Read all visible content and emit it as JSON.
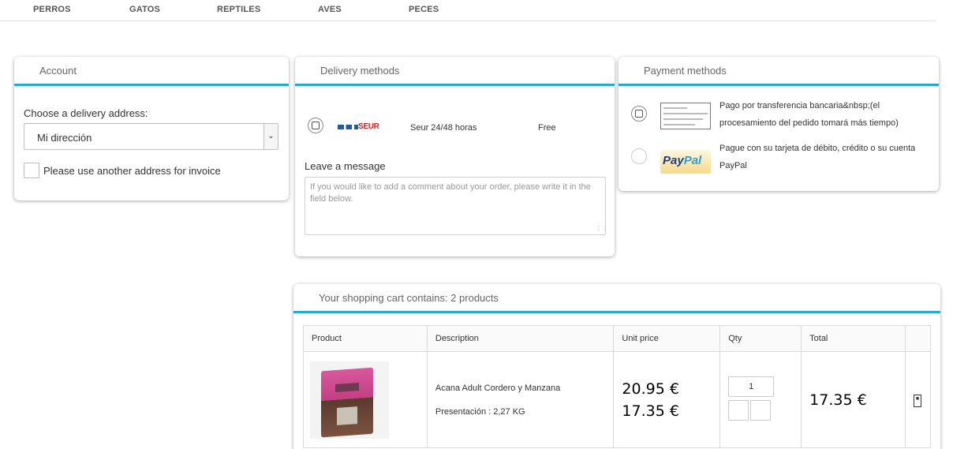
{
  "nav": {
    "items": [
      "PERROS",
      "GATOS",
      "REPTILES",
      "AVES",
      "PECES"
    ]
  },
  "account": {
    "title": "Account",
    "address_label": "Choose a delivery address:",
    "address_selected": "Mi dirección",
    "invoice_label": "Please use another address for invoice"
  },
  "delivery": {
    "title": "Delivery methods",
    "carrier_logo": "SEUR",
    "carrier_name": "Seur 24/48 horas",
    "carrier_price": "Free",
    "message_label": "Leave a message",
    "message_placeholder": "If you would like to add a comment about your order, please write it in the field below."
  },
  "payment": {
    "title": "Payment methods",
    "bank_transfer": "Pago por transferencia bancaria&nbsp;(el procesamiento del pedido tomará más tiempo)",
    "paypal_logo_pay": "Pay",
    "paypal_logo_pal": "Pal",
    "paypal": "Pague con su tarjeta de débito, crédito o su cuenta PayPal"
  },
  "cart": {
    "title": "Your shopping cart contains: 2 products",
    "headers": [
      "Product",
      "Description",
      "Unit price",
      "Qty",
      "Total"
    ],
    "rows": [
      {
        "name": "Acana Adult Cordero y Manzana",
        "attributes": "Presentación : 2,27 KG",
        "old_price": "20.95 €",
        "unit_price": "17.35 €",
        "qty": "1",
        "total": "17.35 €"
      }
    ]
  },
  "colors": {
    "accent": "#27a9cc"
  }
}
